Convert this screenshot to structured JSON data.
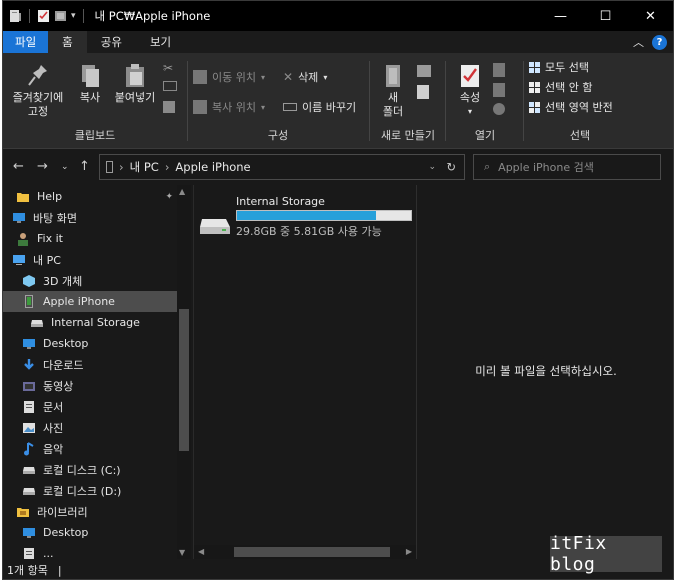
{
  "window": {
    "title": "내 PC₩Apple iPhone",
    "minimize": "—",
    "maximize": "☐",
    "close": "✕"
  },
  "ribbon_tabs": [
    "파일",
    "홈",
    "공유",
    "보기"
  ],
  "ribbon": {
    "clipboard": {
      "label": "클립보드",
      "pin": [
        "즐겨찾기에",
        "고정"
      ],
      "copy": "복사",
      "paste": "붙여넣기"
    },
    "organize": {
      "label": "구성",
      "move_to": "이동 위치",
      "copy_to": "복사 위치",
      "delete": "삭제",
      "rename": "이름 바꾸기"
    },
    "new": {
      "label": "새로 만들기",
      "new_folder": [
        "새",
        "폴더"
      ]
    },
    "open": {
      "label": "열기",
      "properties": "속성"
    },
    "select": {
      "label": "선택",
      "select_all": "모두 선택",
      "select_none": "선택 안 함",
      "invert": "선택 영역 반전"
    }
  },
  "address": {
    "parts": [
      "내 PC",
      "Apple iPhone"
    ],
    "search_placeholder": "Apple iPhone 검색"
  },
  "nav": {
    "items": [
      {
        "label": "Help",
        "icon": "folder-icon"
      },
      {
        "label": "바탕 화면",
        "icon": "desktop-icon"
      },
      {
        "label": "Fix it",
        "icon": "user-icon"
      },
      {
        "label": "내 PC",
        "icon": "pc-icon"
      },
      {
        "label": "3D 개체",
        "icon": "cube-icon"
      },
      {
        "label": "Apple iPhone",
        "icon": "phone-icon"
      },
      {
        "label": "Internal Storage",
        "icon": "drive-icon"
      },
      {
        "label": "Desktop",
        "icon": "desktop-icon"
      },
      {
        "label": "다운로드",
        "icon": "download-icon"
      },
      {
        "label": "동영상",
        "icon": "video-icon"
      },
      {
        "label": "문서",
        "icon": "document-icon"
      },
      {
        "label": "사진",
        "icon": "pictures-icon"
      },
      {
        "label": "음악",
        "icon": "music-icon"
      },
      {
        "label": "로컬 디스크 (C:)",
        "icon": "disk-icon"
      },
      {
        "label": "로컬 디스크 (D:)",
        "icon": "disk-icon"
      },
      {
        "label": "라이브러리",
        "icon": "library-icon"
      },
      {
        "label": "Desktop",
        "icon": "desktop-icon"
      },
      {
        "label": "...",
        "icon": "document-icon"
      }
    ],
    "selected_index": 5
  },
  "content": {
    "drive_name": "Internal Storage",
    "usage_fraction": 0.8,
    "free_text": "29.8GB 중 5.81GB 사용 가능"
  },
  "preview": {
    "message": "미리 볼 파일을 선택하십시오."
  },
  "status": {
    "count": "1개 항목",
    "sep": "|"
  },
  "watermark": "itFix blog",
  "colors": {
    "accent": "#1a74d6",
    "progress": "#26a0da",
    "background": "#191919",
    "ribbon": "#2b2b2b"
  }
}
